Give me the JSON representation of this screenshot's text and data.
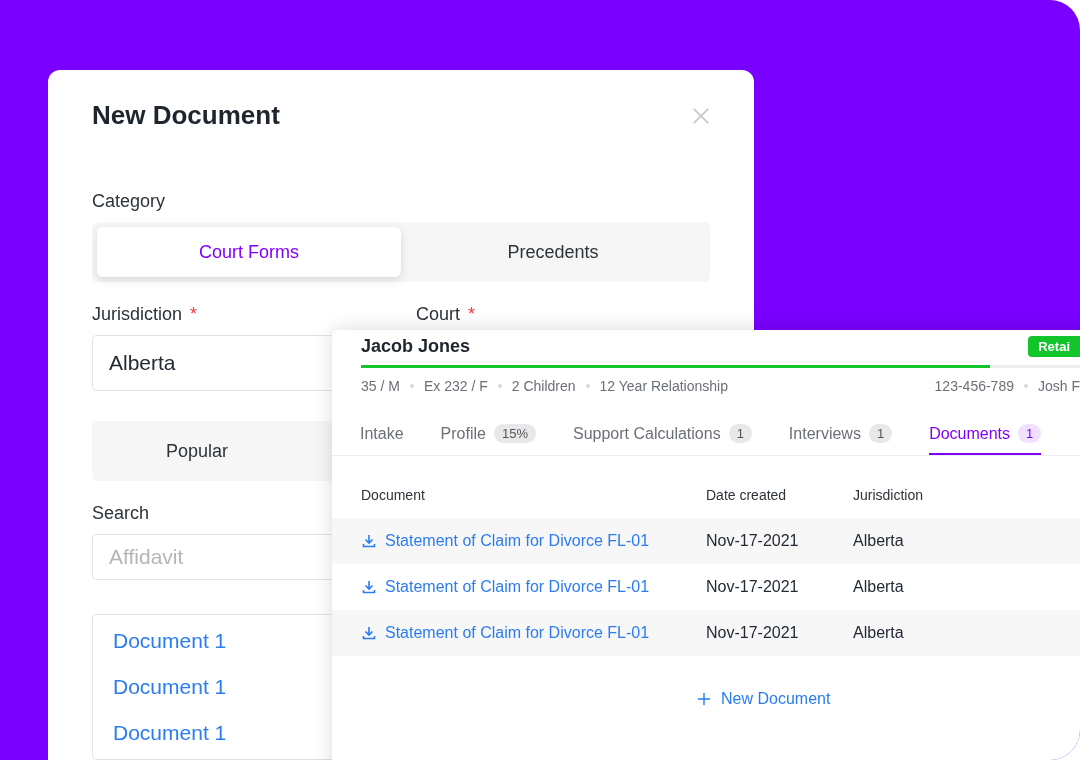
{
  "dialog": {
    "title": "New Document",
    "category_label": "Category",
    "category_options": [
      {
        "label": "Court Forms",
        "selected": true
      },
      {
        "label": "Precedents",
        "selected": false
      }
    ],
    "jurisdiction": {
      "label": "Jurisdiction",
      "required_mark": "*",
      "value": "Alberta"
    },
    "court": {
      "label": "Court",
      "required_mark": "*"
    },
    "list_options": [
      {
        "label": "Popular",
        "selected": false
      }
    ],
    "search": {
      "label": "Search",
      "placeholder": "Affidavit"
    },
    "documents": [
      "Document 1",
      "Document 1",
      "Document 1"
    ]
  },
  "client": {
    "name": "Jacob Jones",
    "status": "Retai",
    "level": 0.86,
    "details": [
      "35 / M",
      "Ex 232 / F",
      "2 Children",
      "12 Year Relationship"
    ],
    "contact": [
      "123-456-789",
      "Josh F"
    ],
    "tabs": [
      {
        "label": "Intake",
        "selected": false
      },
      {
        "label": "Profile",
        "badge": "15%",
        "selected": false
      },
      {
        "label": "Support Calculations",
        "badge": "1",
        "selected": false
      },
      {
        "label": "Interviews",
        "badge": "1",
        "selected": false
      },
      {
        "label": "Documents",
        "badge": "1",
        "selected": true
      }
    ],
    "table": {
      "columns": [
        "Document",
        "Date created",
        "Jurisdiction"
      ],
      "rows": [
        {
          "document": "Statement of Claim for Divorce FL-01",
          "date": "Nov-17-2021",
          "jurisdiction": "Alberta"
        },
        {
          "document": "Statement of Claim for Divorce FL-01",
          "date": "Nov-17-2021",
          "jurisdiction": "Alberta"
        },
        {
          "document": "Statement of Claim for Divorce FL-01",
          "date": "Nov-17-2021",
          "jurisdiction": "Alberta"
        }
      ]
    },
    "new_button": "New Document"
  }
}
